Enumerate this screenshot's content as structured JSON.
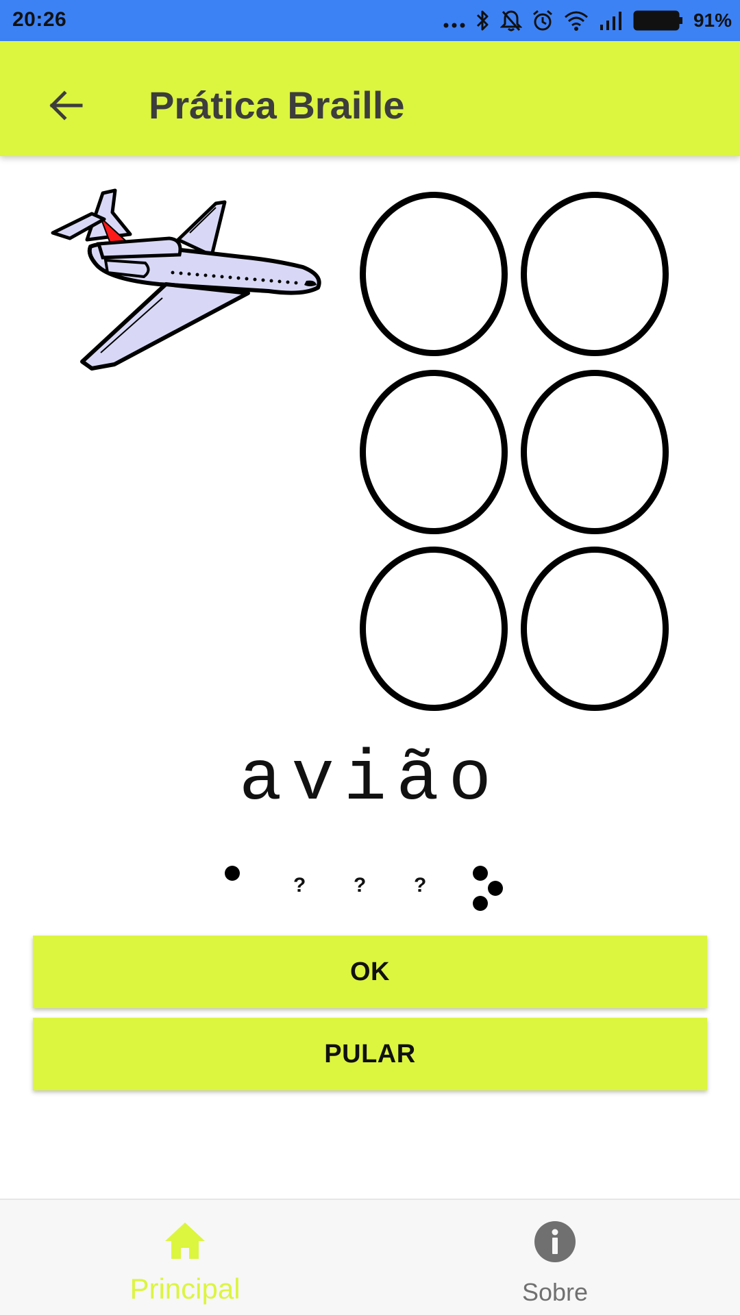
{
  "status_bar": {
    "time": "20:26",
    "battery_percent": "91%",
    "icons": [
      "more-dots-icon",
      "bluetooth-icon",
      "notifications-off-icon",
      "alarm-icon",
      "wifi-icon",
      "cell-signal-icon",
      "battery-icon"
    ]
  },
  "app_bar": {
    "back_icon": "arrow-back-icon",
    "title": "Prática Braille"
  },
  "exercise": {
    "image": "airplane-illustration",
    "word": "avião",
    "braille_cell": {
      "dots": [
        {
          "number": 1,
          "filled": false
        },
        {
          "number": 2,
          "filled": false
        },
        {
          "number": 3,
          "filled": false
        },
        {
          "number": 4,
          "filled": false
        },
        {
          "number": 5,
          "filled": false
        },
        {
          "number": 6,
          "filled": false
        }
      ]
    },
    "braille_preview": [
      {
        "letter": "a",
        "known": true,
        "dots": [
          1
        ]
      },
      {
        "letter": "v",
        "known": false,
        "symbol": "?"
      },
      {
        "letter": "i",
        "known": false,
        "symbol": "?"
      },
      {
        "letter": "ã",
        "known": false,
        "symbol": "?"
      },
      {
        "letter": "o",
        "known": true,
        "dots": [
          1,
          3,
          5
        ]
      }
    ]
  },
  "buttons": {
    "ok_label": "OK",
    "skip_label": "PULAR"
  },
  "bottom_nav": {
    "items": [
      {
        "label": "Principal",
        "icon": "home-icon",
        "active": true
      },
      {
        "label": "Sobre",
        "icon": "info-icon",
        "active": false
      }
    ]
  },
  "colors": {
    "status_bar": "#3d82f5",
    "accent": "#dcf53f",
    "inactive_nav": "#707070"
  }
}
